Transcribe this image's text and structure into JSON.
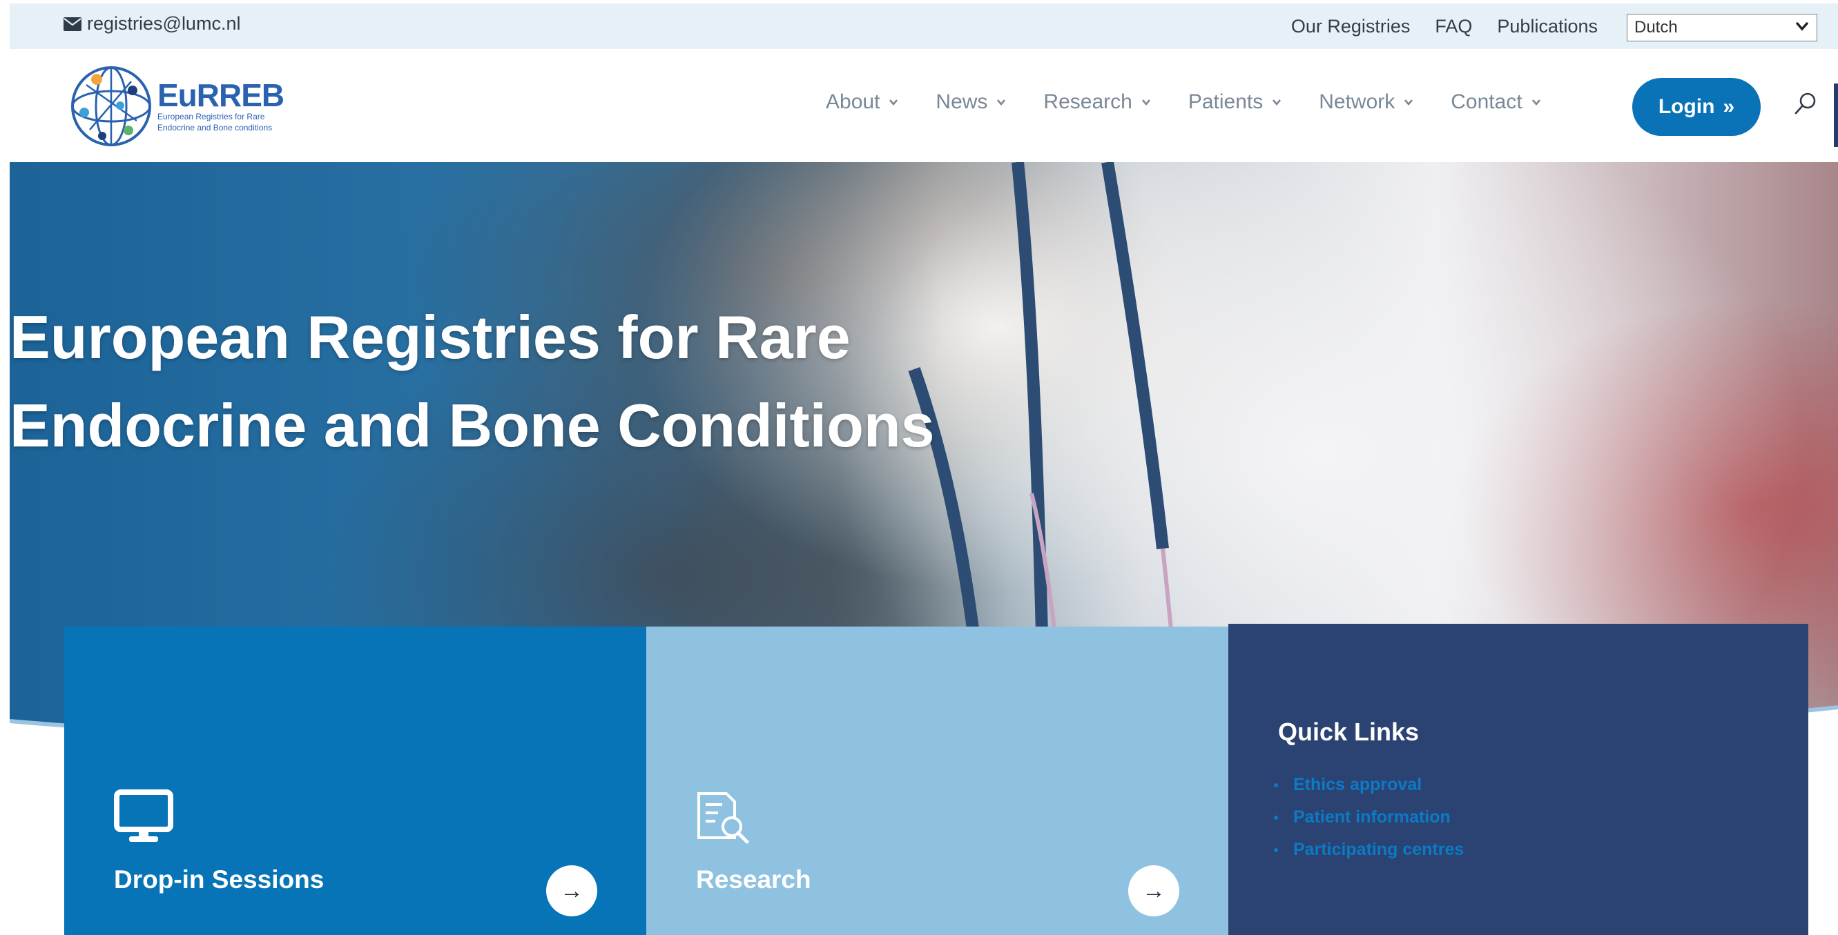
{
  "topbar": {
    "email": "registries@lumc.nl",
    "links": [
      "Our Registries",
      "FAQ",
      "Publications"
    ],
    "language_selected": "Dutch"
  },
  "header": {
    "logo": {
      "brand": "EuRREB",
      "tagline_line1": "European Registries for Rare",
      "tagline_line2": "Endocrine and Bone conditions"
    },
    "nav": [
      "About",
      "News",
      "Research",
      "Patients",
      "Network",
      "Contact"
    ],
    "login_label": "Login",
    "login_arrow": "»"
  },
  "hero": {
    "title_line1": "European Registries for Rare",
    "title_line2": "Endocrine and Bone Conditions"
  },
  "cards": [
    {
      "title": "Drop-in Sessions",
      "icon": "monitor-icon",
      "arrow": "→",
      "color": "#0774b7"
    },
    {
      "title": "Research",
      "icon": "document-search-icon",
      "arrow": "→",
      "color": "#8fc2e0"
    }
  ],
  "quick_links": {
    "title": "Quick Links",
    "items": [
      "Ethics approval",
      "Patient information",
      "Participating centres"
    ],
    "color": "#2b4372"
  },
  "colors": {
    "primary": "#0a73b8",
    "navy": "#2b4372",
    "light_blue": "#8fc2e0",
    "topbar_bg": "#e6f0f7"
  }
}
